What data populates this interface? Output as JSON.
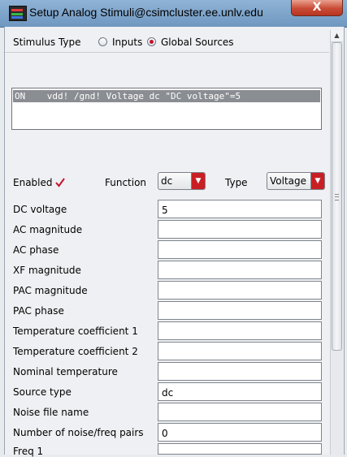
{
  "window": {
    "title": "Setup Analog Stimuli@csimcluster.ee.unlv.edu",
    "close_label": "X"
  },
  "stimulus_type": {
    "label": "Stimulus Type",
    "options": [
      {
        "label": "Inputs",
        "selected": false
      },
      {
        "label": "Global Sources",
        "selected": true
      }
    ]
  },
  "stimulus_list": {
    "rows": [
      "ON    vdd! /gnd! Voltage dc \"DC voltage\"=5"
    ]
  },
  "controls": {
    "enabled_label": "Enabled",
    "enabled_checked": true,
    "function_label": "Function",
    "function_value": "dc",
    "type_label": "Type",
    "type_value": "Voltage"
  },
  "fields": [
    {
      "label": "DC voltage",
      "value": "5"
    },
    {
      "label": "AC magnitude",
      "value": ""
    },
    {
      "label": "AC phase",
      "value": ""
    },
    {
      "label": "XF magnitude",
      "value": ""
    },
    {
      "label": "PAC magnitude",
      "value": ""
    },
    {
      "label": "PAC phase",
      "value": ""
    },
    {
      "label": "Temperature coefficient 1",
      "value": ""
    },
    {
      "label": "Temperature coefficient 2",
      "value": ""
    },
    {
      "label": "Nominal temperature",
      "value": ""
    },
    {
      "label": "Source type",
      "value": "dc"
    },
    {
      "label": "Noise file name",
      "value": ""
    },
    {
      "label": "Number of noise/freq pairs",
      "value": "0"
    },
    {
      "label": "Freq 1",
      "value": ""
    }
  ],
  "colors": {
    "accent_red": "#c81f25",
    "selection_gray": "#8a8e93",
    "titlebar_blue": "#7fa5cb"
  }
}
